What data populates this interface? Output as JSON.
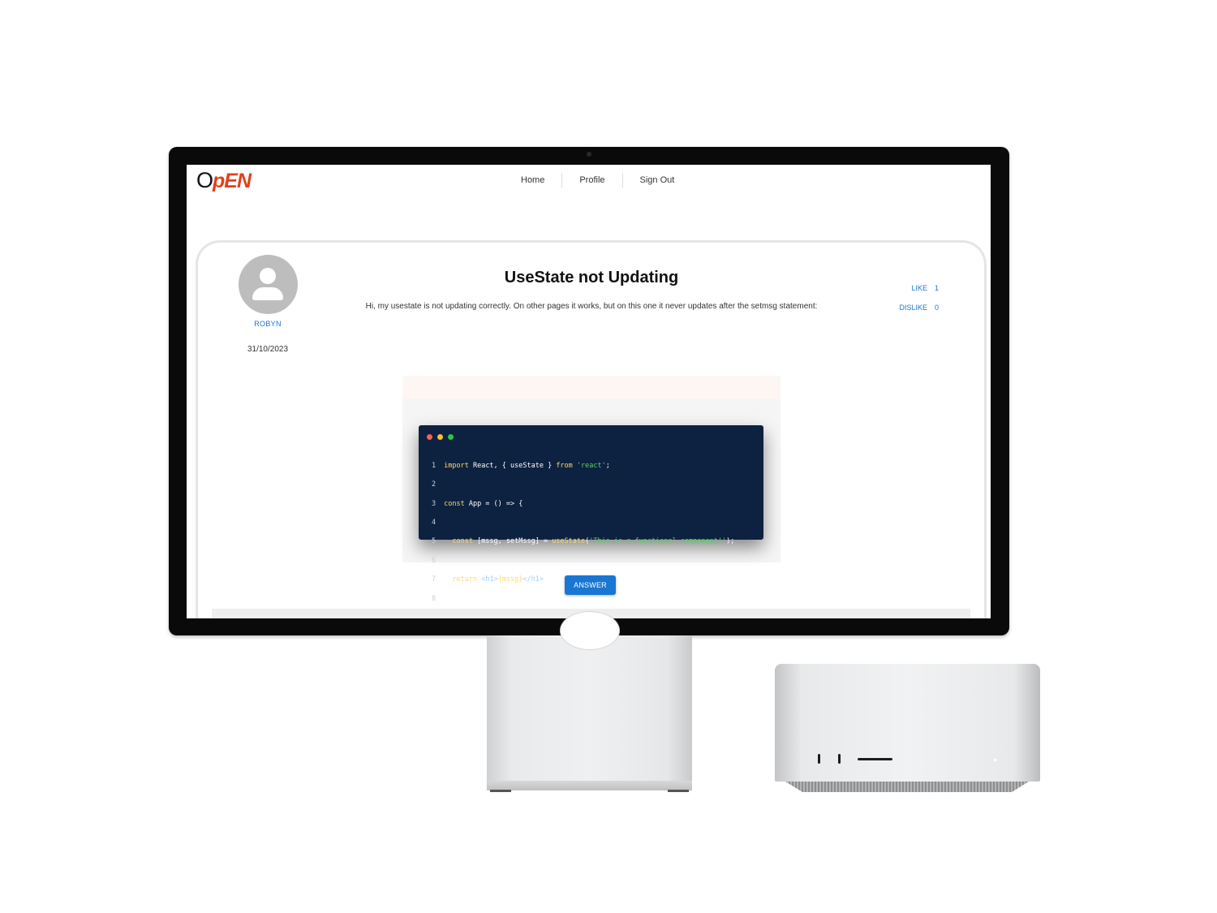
{
  "brand": {
    "logo_first": "O",
    "logo_rest": "pEN"
  },
  "nav": {
    "items": [
      {
        "label": "Home"
      },
      {
        "label": "Profile"
      },
      {
        "label": "Sign Out"
      }
    ]
  },
  "post": {
    "author": "ROBYN",
    "date": "31/10/2023",
    "title": "UseState not Updating",
    "body": "Hi, my usestate is not updating correctly. On other pages it works, but on this one it never updates after the setmsg statement:",
    "reactions": {
      "like_label": "LIKE",
      "like_count": "1",
      "dislike_label": "DISLIKE",
      "dislike_count": "0"
    },
    "code": {
      "window_dots": [
        "#ff5f56",
        "#ffbd2e",
        "#27c93f"
      ],
      "lines": [
        {
          "n": "1",
          "kw1": "import",
          "plain1": " React, { useState } ",
          "kw2": "from",
          "plain2": " ",
          "str": "'react'",
          "plain3": ";"
        },
        {
          "n": "2"
        },
        {
          "n": "3",
          "kw1": "const",
          "plain1": " App = () => {"
        },
        {
          "n": "4"
        },
        {
          "n": "5",
          "kw1": "  const",
          "plain1": " [mssg, setMssg] = ",
          "kw2": "useState",
          "plain2": "(",
          "str": "'This is a functional component!'",
          "plain3": ");"
        },
        {
          "n": "6"
        },
        {
          "n": "7",
          "kw1": "  return",
          "plain1": " ",
          "tag1": "<h1>",
          "kw2": "{mssg}",
          "tag2": "</h1>"
        },
        {
          "n": "8",
          "plain1": "}"
        }
      ]
    }
  },
  "actions": {
    "answer_label": "ANSWER"
  },
  "colors": {
    "accent": "#1976d2",
    "logo_accent": "#e2401c",
    "code_bg": "#0d2140"
  }
}
